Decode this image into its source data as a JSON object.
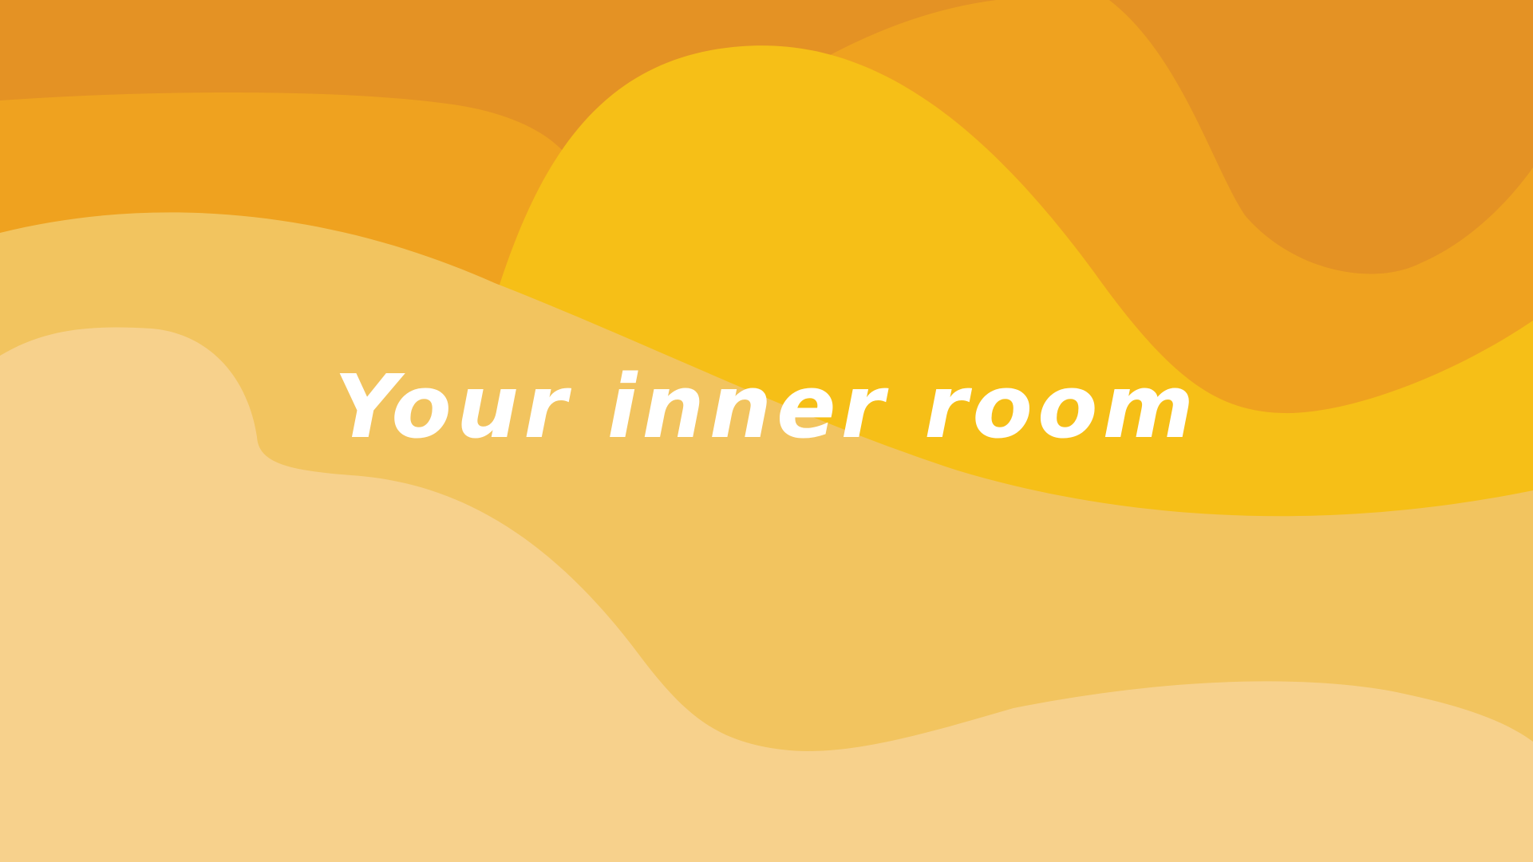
{
  "headline": "Your inner room",
  "palette": {
    "background": "#E49224",
    "wave_orange": "#EFA21F",
    "sun_yellow": "#F6BF17",
    "sand_mid": "#F2C45F",
    "sand_light": "#F7D18C",
    "text": "#FFFFFF"
  }
}
